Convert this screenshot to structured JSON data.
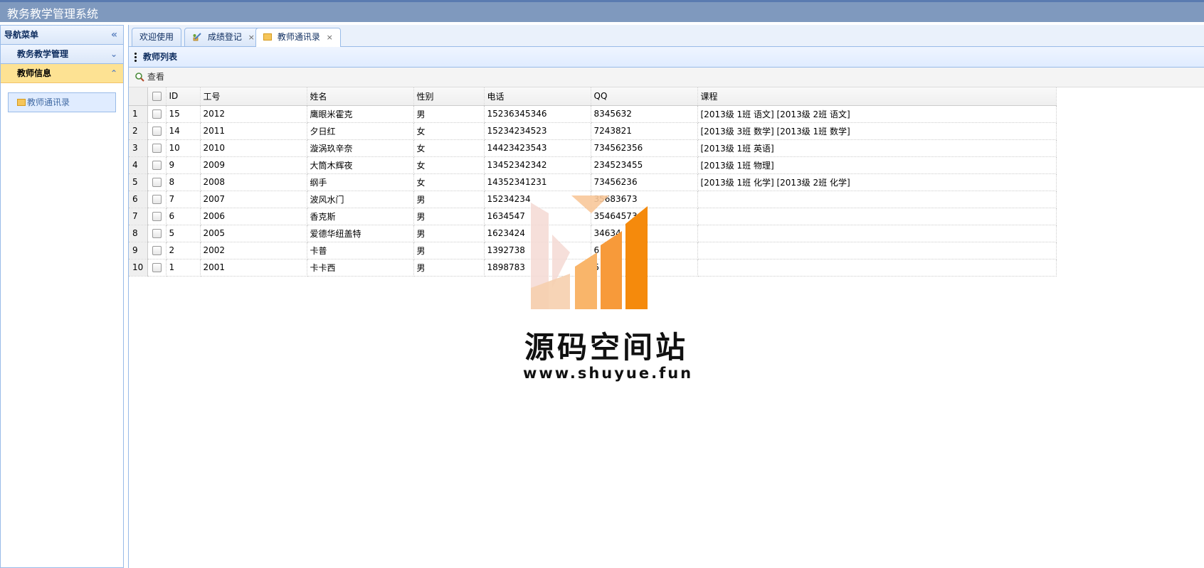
{
  "app": {
    "title": "教务教学管理系统"
  },
  "nav": {
    "header": "导航菜单",
    "sections": [
      {
        "label": "教务教学管理"
      },
      {
        "label": "教师信息"
      }
    ],
    "active_link": "教师通讯录"
  },
  "tabs": [
    {
      "label": "欢迎使用"
    },
    {
      "label": "成绩登记"
    },
    {
      "label": "教师通讯录"
    }
  ],
  "panel": {
    "title": "教师列表"
  },
  "toolbar": {
    "view_label": "查看"
  },
  "grid": {
    "columns": [
      "ID",
      "工号",
      "姓名",
      "性别",
      "电话",
      "QQ",
      "课程"
    ],
    "rows": [
      {
        "n": "1",
        "id": "15",
        "no": "2012",
        "name": "鹰眼米霍克",
        "sex": "男",
        "phone": "15236345346",
        "qq": "8345632",
        "course": "[2013级 1班 语文]    [2013级 2班 语文]"
      },
      {
        "n": "2",
        "id": "14",
        "no": "2011",
        "name": "夕日红",
        "sex": "女",
        "phone": "15234234523",
        "qq": "7243821",
        "course": "[2013级 3班 数学]    [2013级 1班 数学]"
      },
      {
        "n": "3",
        "id": "10",
        "no": "2010",
        "name": "漩涡玖辛奈",
        "sex": "女",
        "phone": "14423423543",
        "qq": "734562356",
        "course": "[2013级 1班 英语]"
      },
      {
        "n": "4",
        "id": "9",
        "no": "2009",
        "name": "大筒木辉夜",
        "sex": "女",
        "phone": "13452342342",
        "qq": "234523455",
        "course": "[2013级 1班 物理]"
      },
      {
        "n": "5",
        "id": "8",
        "no": "2008",
        "name": "纲手",
        "sex": "女",
        "phone": "14352341231",
        "qq": "73456236",
        "course": "[2013级 1班 化学]    [2013级 2班 化学]"
      },
      {
        "n": "6",
        "id": "7",
        "no": "2007",
        "name": "波风水门",
        "sex": "男",
        "phone": "15234234",
        "qq": "35683673",
        "course": ""
      },
      {
        "n": "7",
        "id": "6",
        "no": "2006",
        "name": "香克斯",
        "sex": "男",
        "phone": "1634547",
        "qq": "35464573",
        "course": ""
      },
      {
        "n": "8",
        "id": "5",
        "no": "2005",
        "name": "爱德华纽盖特",
        "sex": "男",
        "phone": "1623424",
        "qq": "34634",
        "course": ""
      },
      {
        "n": "9",
        "id": "2",
        "no": "2002",
        "name": "卡普",
        "sex": "男",
        "phone": "1392738",
        "qq": "6",
        "course": ""
      },
      {
        "n": "10",
        "id": "1",
        "no": "2001",
        "name": "卡卡西",
        "sex": "男",
        "phone": "1898783",
        "qq": "5",
        "course": ""
      }
    ]
  },
  "watermark": {
    "text": "源码空间站",
    "url": "www.shuyue.fun"
  },
  "colors": {
    "header_bg": "#7f99be",
    "selected_accordion": "#fde293",
    "border": "#99bbe8"
  }
}
